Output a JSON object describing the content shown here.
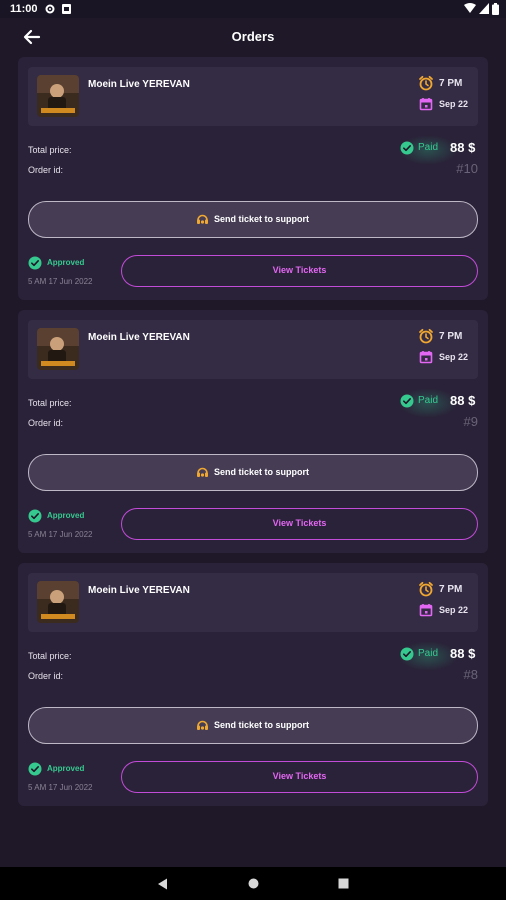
{
  "status_bar": {
    "time": "11:00"
  },
  "app_bar": {
    "title": "Orders"
  },
  "colors": {
    "accent_pink": "#e267f2",
    "success_green": "#35c98f",
    "icon_orange": "#f0a830"
  },
  "orders": [
    {
      "event_title": "Moein Live YEREVAN",
      "time": "7 PM",
      "date": "Sep 22",
      "total_label": "Total price:",
      "paid_label": "Paid",
      "price": "88 $",
      "order_label": "Order id:",
      "order_id": "#10",
      "support_label": "Send ticket to support",
      "status": "Approved",
      "status_date": "5 AM   17 Jun 2022",
      "view_label": "View Tickets"
    },
    {
      "event_title": "Moein Live YEREVAN",
      "time": "7 PM",
      "date": "Sep 22",
      "total_label": "Total price:",
      "paid_label": "Paid",
      "price": "88 $",
      "order_label": "Order id:",
      "order_id": "#9",
      "support_label": "Send ticket to support",
      "status": "Approved",
      "status_date": "5 AM   17 Jun 2022",
      "view_label": "View Tickets"
    },
    {
      "event_title": "Moein Live YEREVAN",
      "time": "7 PM",
      "date": "Sep 22",
      "total_label": "Total price:",
      "paid_label": "Paid",
      "price": "88 $",
      "order_label": "Order id:",
      "order_id": "#8",
      "support_label": "Send ticket to support",
      "status": "Approved",
      "status_date": "5 AM   17 Jun 2022",
      "view_label": "View Tickets"
    }
  ]
}
